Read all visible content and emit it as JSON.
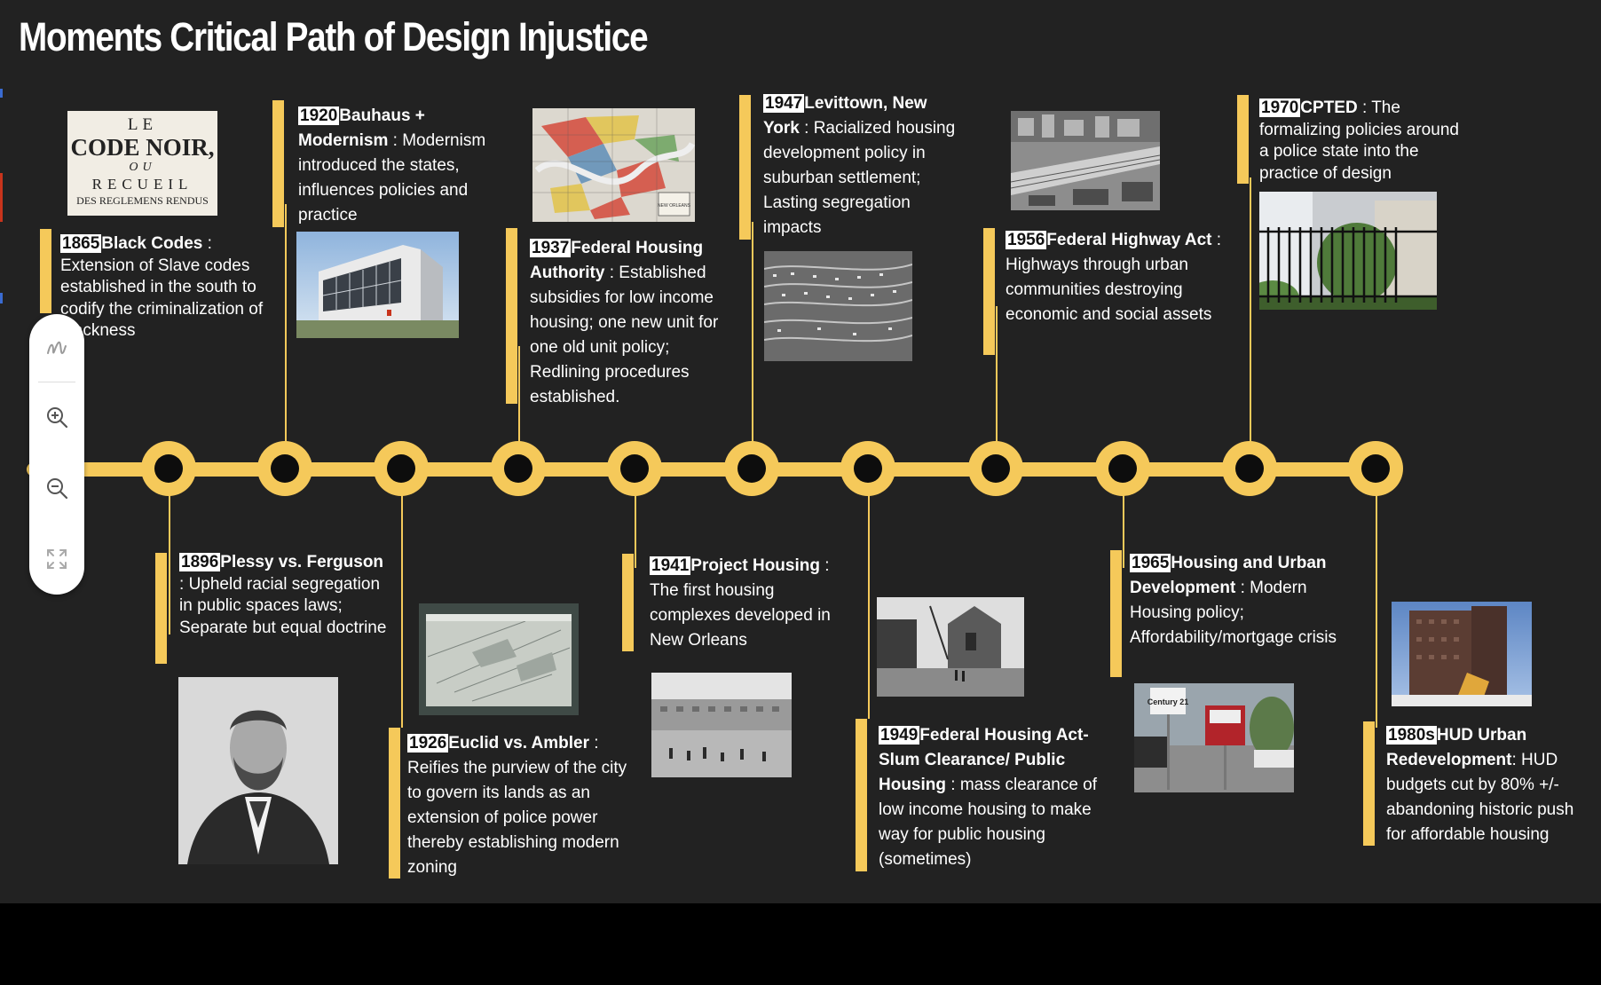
{
  "title": "Moments Critical Path of Design Injustice",
  "colors": {
    "accent": "#f5c95a",
    "background": "#222222",
    "text": "#ffffff"
  },
  "events": [
    {
      "year": "1865",
      "title": "Black Codes",
      "sep": " : ",
      "desc": "Extension of Slave codes established in the south to codify the criminalization of blackness"
    },
    {
      "year": "1896",
      "title": "Plessy vs. Ferguson",
      "sep": " : ",
      "desc": "Upheld racial segregation in public spaces laws; Separate but equal doctrine"
    },
    {
      "year": "1920",
      "title": "Bauhaus + Modernism",
      "sep": " : ",
      "desc": "Modernism introduced the states, influences policies and practice"
    },
    {
      "year": "1926",
      "title": "Euclid vs. Ambler",
      "sep": " : ",
      "desc": "Reifies the purview of the city to govern its lands as an extension of police power thereby establishing modern zoning"
    },
    {
      "year": "1937",
      "title": "Federal Housing Authority",
      "sep": " : ",
      "desc": "Established subsidies for low income housing; one new unit for one old unit policy; Redlining procedures established."
    },
    {
      "year": "1941",
      "title": "Project Housing",
      "sep": " : ",
      "desc": "The first housing complexes developed in New Orleans"
    },
    {
      "year": "1947",
      "title": "Levittown, New York",
      "sep": " : ",
      "desc": "Racialized housing development policy in suburban settlement; Lasting segregation impacts"
    },
    {
      "year": "1949",
      "title": "Federal Housing Act-Slum Clearance/ Public Housing",
      "sep": " : ",
      "desc": "mass clearance of low income housing to make way for public housing (sometimes)"
    },
    {
      "year": "1956",
      "title": "Federal Highway Act",
      "sep": " : ",
      "desc": "Highways through urban communities destroying economic and social assets"
    },
    {
      "year": "1965",
      "title": "Housing and Urban Development",
      "sep": " : ",
      "desc": "Modern Housing policy; Affordability/mortgage crisis"
    },
    {
      "year": "1970",
      "title": "CPTED",
      "sep": " : ",
      "desc": "The formalizing policies around a police state into the practice of design"
    },
    {
      "year": "1980s",
      "title": "HUD Urban Redevelopment",
      "sep": ": ",
      "desc": "HUD budgets cut by 80% +/- abandoning historic push for affordable housing"
    }
  ],
  "code_noir": [
    "LE",
    "CODE NOIR,",
    "OU",
    "RECUEIL",
    "DES REGLEMENS RENDUS"
  ],
  "map_label": "NEW ORLEANS",
  "billboard_text": "Century 21",
  "toolbar": {
    "tools": [
      {
        "name": "draw-tool-button",
        "icon": "scribble-icon"
      },
      {
        "name": "zoom-in-button",
        "icon": "zoom-in-icon"
      },
      {
        "name": "zoom-out-button",
        "icon": "zoom-out-icon"
      },
      {
        "name": "fullscreen-button",
        "icon": "expand-icon"
      }
    ]
  }
}
